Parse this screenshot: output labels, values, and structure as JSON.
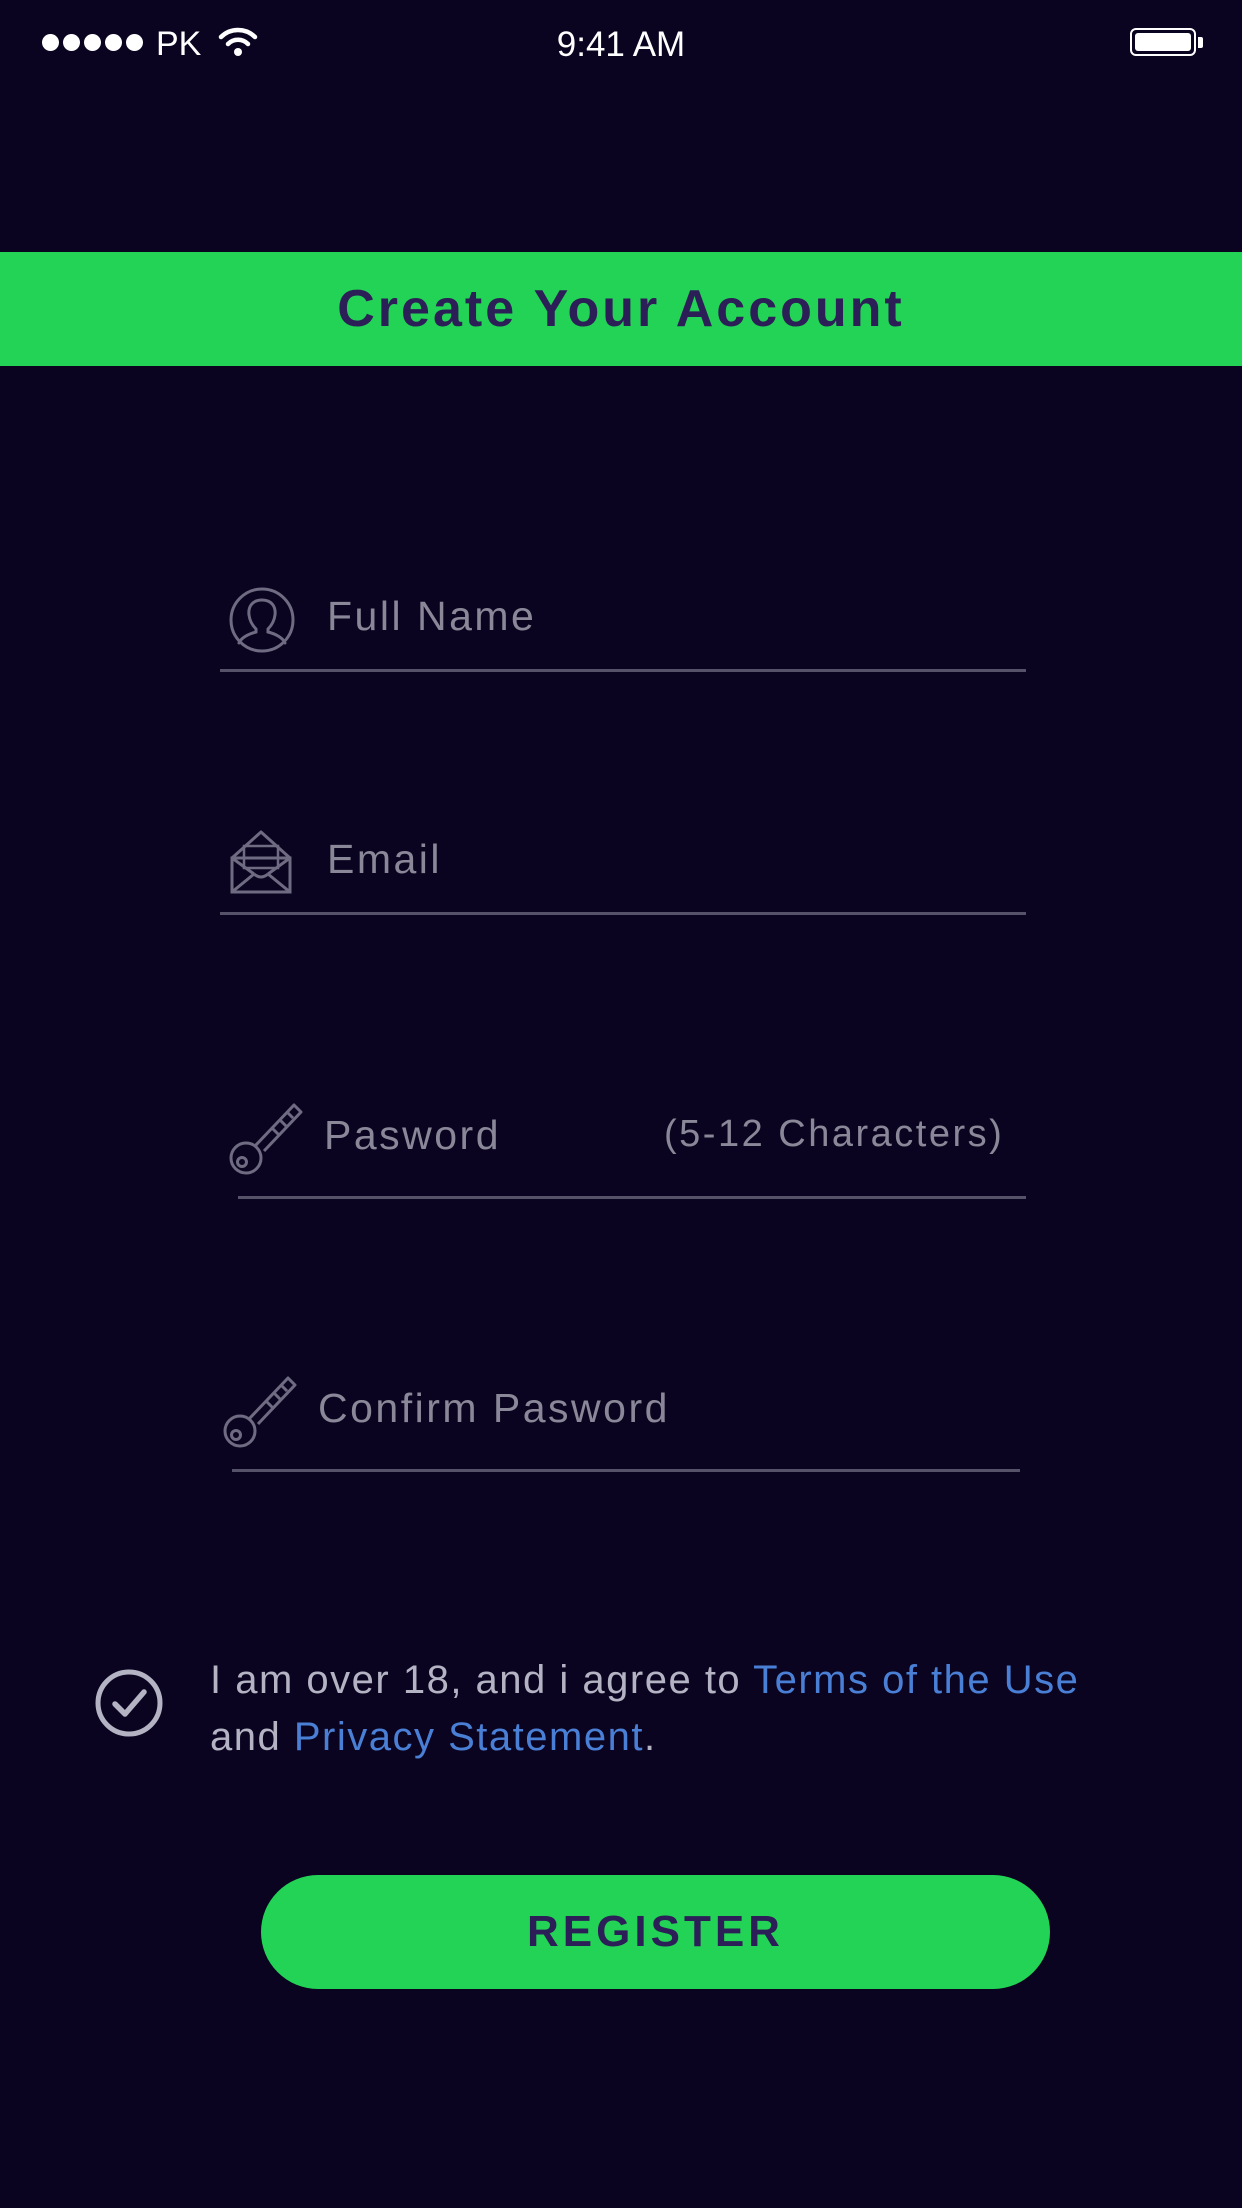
{
  "status_bar": {
    "carrier": "PK",
    "time": "9:41 AM",
    "signal_bars": 5,
    "battery_level": 1.0
  },
  "header": {
    "title": "Create Your Account"
  },
  "form": {
    "full_name": {
      "icon": "user-icon",
      "placeholder": "Full Name",
      "value": ""
    },
    "email": {
      "icon": "envelope-icon",
      "placeholder": "Email",
      "value": ""
    },
    "password": {
      "icon": "key-icon",
      "placeholder": "Pasword",
      "hint": "(5-12 Characters)",
      "value": ""
    },
    "confirm_password": {
      "icon": "key-icon",
      "placeholder": "Confirm Pasword",
      "value": ""
    }
  },
  "agreement": {
    "checked": true,
    "text_before": "I am over 18, and i agree to ",
    "terms_link": "Terms of the Use",
    "text_middle": "and ",
    "privacy_link": "Privacy Statement",
    "text_after": "."
  },
  "register_button": {
    "label": "REGISTER"
  },
  "colors": {
    "background": "#0b0420",
    "accent_green": "#22d355",
    "title_text": "#2c1e57",
    "placeholder": "#8a8798",
    "link_blue": "#4a7fd6",
    "underline": "#56526a"
  }
}
